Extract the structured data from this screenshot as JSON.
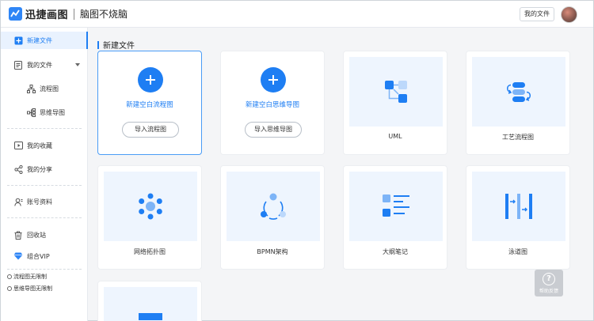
{
  "header": {
    "logo_name": "迅捷画图",
    "slogan": "脑图不烧脑",
    "my_files_button": "我的文件"
  },
  "sidebar": {
    "new_file": "新建文件",
    "my_files": "我的文件",
    "flowchart": "流程图",
    "mindmap": "思维导图",
    "favorites": "我的收藏",
    "shares": "我的分享",
    "account": "账号资料",
    "recycle": "回收站",
    "vip": "组合VIP",
    "notes": [
      "流程图无限制",
      "思维导图无限制"
    ]
  },
  "main": {
    "section_title": "新建文件",
    "new_flowchart": {
      "label": "新建空白流程图",
      "import": "导入流程图"
    },
    "new_mindmap": {
      "label": "新建空白思维导图",
      "import": "导入思维导图"
    },
    "templates": [
      "UML",
      "工艺流程图",
      "网络拓扑图",
      "BPMN架构",
      "大纲笔记",
      "泳道图"
    ]
  },
  "help": {
    "label": "帮助反馈",
    "glyph": "?"
  },
  "colors": {
    "accent": "#1e7ef3",
    "thumb_bg": "#eef5fe"
  }
}
